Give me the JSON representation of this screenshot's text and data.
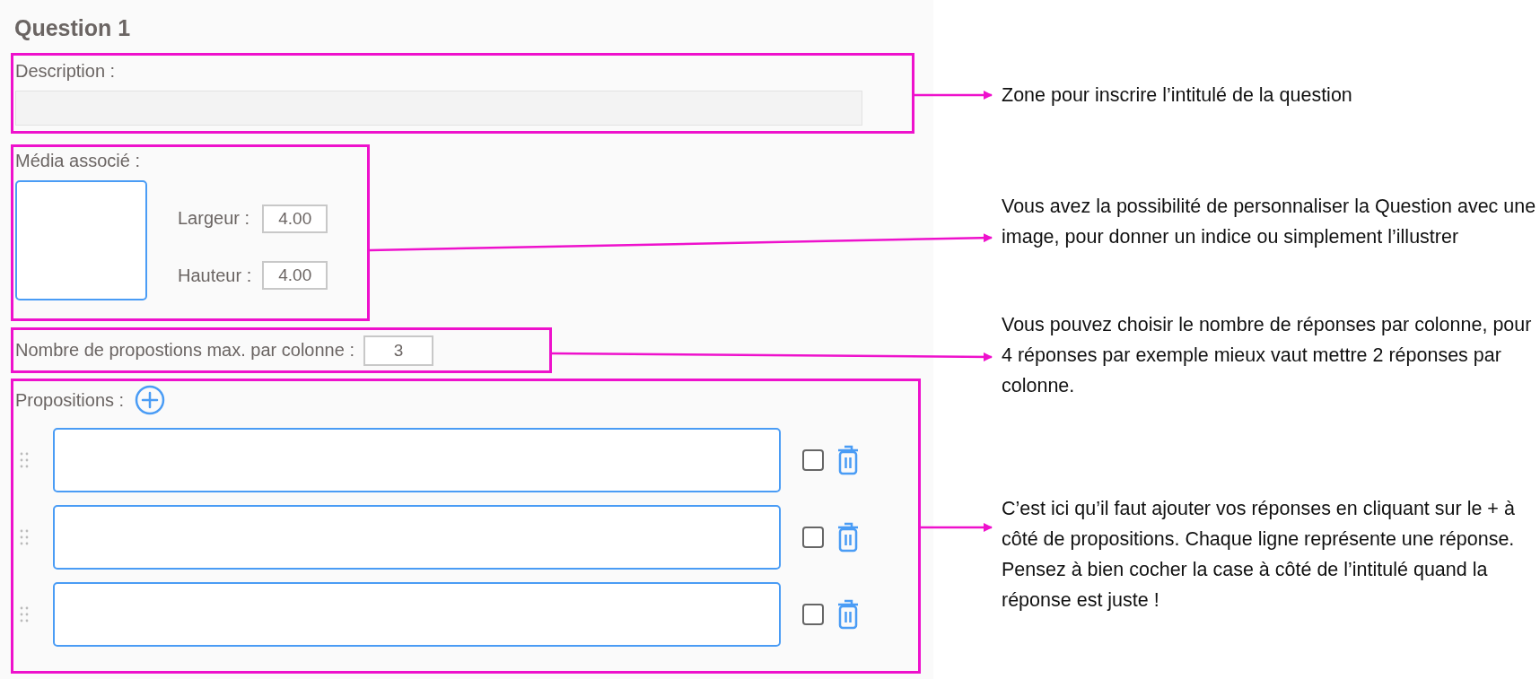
{
  "title": "Question 1",
  "description": {
    "label": "Description :"
  },
  "media": {
    "label": "Média associé :",
    "width_label": "Largeur :",
    "width_value": "4.00",
    "height_label": "Hauteur :",
    "height_value": "4.00"
  },
  "max_per_column": {
    "label": "Nombre de propostions max. par colonne :",
    "value": "3"
  },
  "propositions": {
    "label": "Propositions :",
    "rows": [
      {
        "checked": false
      },
      {
        "checked": false
      },
      {
        "checked": false
      }
    ]
  },
  "annotations": [
    {
      "text": "Zone pour inscrire l’intitulé de la question"
    },
    {
      "text": "Vous avez la possibilité de personnaliser la Question avec une image, pour donner un indice ou simplement l’illustrer"
    },
    {
      "text": "Vous pouvez choisir le nombre de réponses par colonne, pour 4 réponses par exemple mieux vaut mettre 2 réponses par colonne."
    },
    {
      "text": "C’est ici qu’il faut ajouter vos réponses en cliquant sur le + à côté de propositions. Chaque ligne représente une réponse. Pensez à bien cocher la case à côté de l’intitulé quand la réponse est juste !"
    }
  ]
}
